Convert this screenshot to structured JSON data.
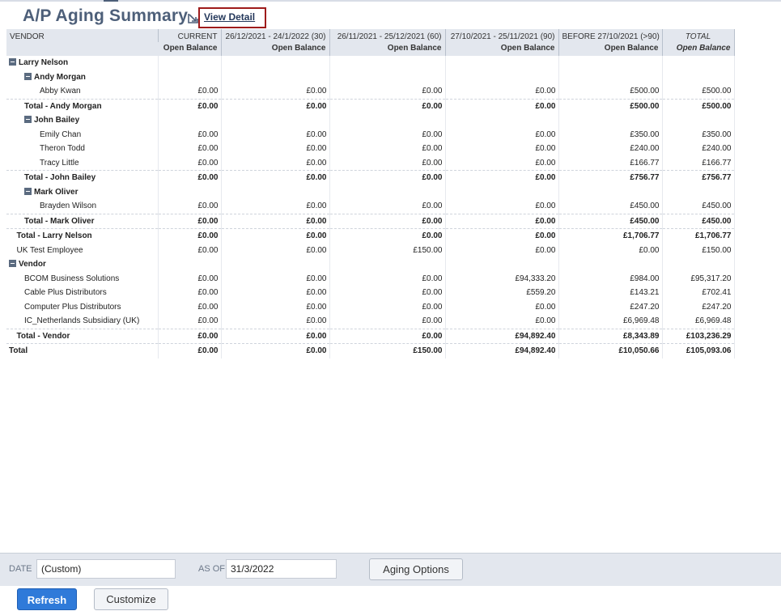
{
  "header": {
    "title": "A/P Aging Summary",
    "view_detail": "View Detail"
  },
  "table": {
    "col_headers": [
      "VENDOR",
      "CURRENT",
      "26/12/2021 - 24/1/2022 (30)",
      "26/11/2021 - 25/12/2021 (60)",
      "27/10/2021 - 25/11/2021 (90)",
      "BEFORE 27/10/2021 (>90)",
      "TOTAL"
    ],
    "sub_header": "Open Balance",
    "rows": [
      {
        "label": "Larry Nelson",
        "indent": 0,
        "toggle": true,
        "type": "group",
        "values": [
          "",
          "",
          "",
          "",
          "",
          ""
        ]
      },
      {
        "label": "Andy Morgan",
        "indent": 1,
        "toggle": true,
        "type": "group",
        "values": [
          "",
          "",
          "",
          "",
          "",
          ""
        ]
      },
      {
        "label": "Abby Kwan",
        "indent": 2,
        "type": "item",
        "values": [
          "£0.00",
          "£0.00",
          "£0.00",
          "£0.00",
          "£500.00",
          "£500.00"
        ]
      },
      {
        "label": "Total - Andy Morgan",
        "indent": 1,
        "type": "total",
        "values": [
          "£0.00",
          "£0.00",
          "£0.00",
          "£0.00",
          "£500.00",
          "£500.00"
        ]
      },
      {
        "label": "John Bailey",
        "indent": 1,
        "toggle": true,
        "type": "group",
        "values": [
          "",
          "",
          "",
          "",
          "",
          ""
        ]
      },
      {
        "label": "Emily Chan",
        "indent": 2,
        "type": "item",
        "values": [
          "£0.00",
          "£0.00",
          "£0.00",
          "£0.00",
          "£350.00",
          "£350.00"
        ]
      },
      {
        "label": "Theron Todd",
        "indent": 2,
        "type": "item",
        "values": [
          "£0.00",
          "£0.00",
          "£0.00",
          "£0.00",
          "£240.00",
          "£240.00"
        ]
      },
      {
        "label": "Tracy Little",
        "indent": 2,
        "type": "item",
        "values": [
          "£0.00",
          "£0.00",
          "£0.00",
          "£0.00",
          "£166.77",
          "£166.77"
        ]
      },
      {
        "label": "Total - John Bailey",
        "indent": 1,
        "type": "total",
        "values": [
          "£0.00",
          "£0.00",
          "£0.00",
          "£0.00",
          "£756.77",
          "£756.77"
        ]
      },
      {
        "label": "Mark Oliver",
        "indent": 1,
        "toggle": true,
        "type": "group",
        "values": [
          "",
          "",
          "",
          "",
          "",
          ""
        ]
      },
      {
        "label": "Brayden Wilson",
        "indent": 2,
        "type": "item",
        "values": [
          "£0.00",
          "£0.00",
          "£0.00",
          "£0.00",
          "£450.00",
          "£450.00"
        ]
      },
      {
        "label": "Total - Mark Oliver",
        "indent": 1,
        "type": "total",
        "values": [
          "£0.00",
          "£0.00",
          "£0.00",
          "£0.00",
          "£450.00",
          "£450.00"
        ]
      },
      {
        "label": "Total - Larry Nelson",
        "indent": 0.5,
        "type": "total",
        "values": [
          "£0.00",
          "£0.00",
          "£0.00",
          "£0.00",
          "£1,706.77",
          "£1,706.77"
        ]
      },
      {
        "label": "UK Test Employee",
        "indent": 0.5,
        "type": "item",
        "values": [
          "£0.00",
          "£0.00",
          "£150.00",
          "£0.00",
          "£0.00",
          "£150.00"
        ]
      },
      {
        "label": "Vendor",
        "indent": 0,
        "toggle": true,
        "type": "group",
        "values": [
          "",
          "",
          "",
          "",
          "",
          ""
        ]
      },
      {
        "label": "BCOM Business Solutions",
        "indent": 1,
        "type": "item",
        "values": [
          "£0.00",
          "£0.00",
          "£0.00",
          "£94,333.20",
          "£984.00",
          "£95,317.20"
        ]
      },
      {
        "label": "Cable Plus Distributors",
        "indent": 1,
        "type": "item",
        "values": [
          "£0.00",
          "£0.00",
          "£0.00",
          "£559.20",
          "£143.21",
          "£702.41"
        ]
      },
      {
        "label": "Computer Plus Distributors",
        "indent": 1,
        "type": "item",
        "values": [
          "£0.00",
          "£0.00",
          "£0.00",
          "£0.00",
          "£247.20",
          "£247.20"
        ]
      },
      {
        "label": "IC_Netherlands Subsidiary (UK)",
        "indent": 1,
        "type": "item",
        "values": [
          "£0.00",
          "£0.00",
          "£0.00",
          "£0.00",
          "£6,969.48",
          "£6,969.48"
        ]
      },
      {
        "label": "Total - Vendor",
        "indent": 0.5,
        "type": "total",
        "values": [
          "£0.00",
          "£0.00",
          "£0.00",
          "£94,892.40",
          "£8,343.89",
          "£103,236.29"
        ]
      },
      {
        "label": "Total",
        "indent": 0,
        "type": "total",
        "values": [
          "£0.00",
          "£0.00",
          "£150.00",
          "£94,892.40",
          "£10,050.66",
          "£105,093.06"
        ]
      }
    ]
  },
  "filters": {
    "date_label": "DATE",
    "date_value": "(Custom)",
    "asof_label": "AS OF",
    "asof_value": "31/3/2022",
    "aging_options": "Aging Options"
  },
  "actions": {
    "refresh": "Refresh",
    "customize": "Customize"
  }
}
